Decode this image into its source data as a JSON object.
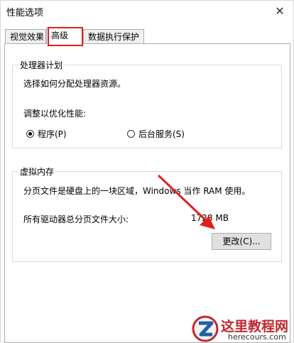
{
  "window": {
    "title": "性能选项",
    "close_glyph": "✕"
  },
  "tabs": [
    {
      "label": "视觉效果"
    },
    {
      "label": "高级"
    },
    {
      "label": "数据执行保护"
    }
  ],
  "processor": {
    "group_label": "处理器计划",
    "description": "选择如何分配处理器资源。",
    "adjust_label": "调整以优化性能:",
    "option_programs": "程序(P)",
    "option_services": "后台服务(S)"
  },
  "virtual_memory": {
    "group_label": "虚拟内存",
    "description": "分页文件是硬盘上的一块区域，Windows 当作 RAM 使用。",
    "total_label": "所有驱动器总分页文件大小:",
    "total_value": "1728 MB",
    "change_button": "更改(C)..."
  },
  "watermark": {
    "title": "这里教程网",
    "url": "herecours.com"
  },
  "colors": {
    "highlight": "#e02020",
    "arrow": "#e02020",
    "watermark_red": "#c0282d"
  }
}
